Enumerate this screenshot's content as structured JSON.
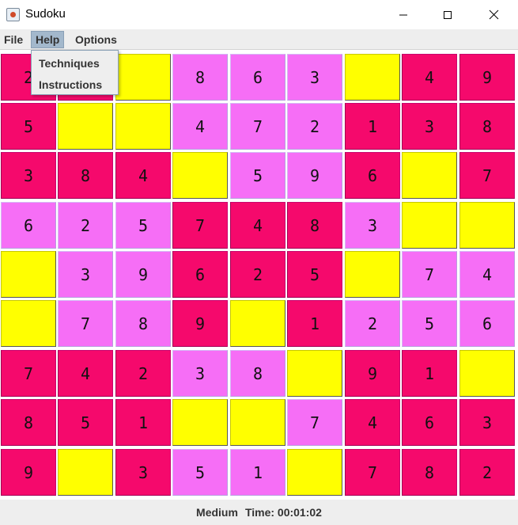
{
  "window": {
    "title": "Sudoku"
  },
  "menu": {
    "file": "File",
    "help": "Help",
    "options": "Options"
  },
  "help_menu": {
    "items": [
      "Techniques",
      "Instructions"
    ]
  },
  "board": {
    "rows": [
      [
        "2",
        "",
        "",
        "8",
        "6",
        "3",
        "",
        "4",
        "9"
      ],
      [
        "5",
        "",
        "",
        "4",
        "7",
        "2",
        "1",
        "3",
        "8"
      ],
      [
        "3",
        "8",
        "4",
        "",
        "5",
        "9",
        "6",
        "",
        "7"
      ],
      [
        "6",
        "2",
        "5",
        "7",
        "4",
        "8",
        "3",
        "",
        ""
      ],
      [
        "",
        "3",
        "9",
        "6",
        "2",
        "5",
        "",
        "7",
        "4"
      ],
      [
        "",
        "7",
        "8",
        "9",
        "",
        "1",
        "2",
        "5",
        "6"
      ],
      [
        "7",
        "4",
        "2",
        "3",
        "8",
        "",
        "9",
        "1",
        ""
      ],
      [
        "8",
        "5",
        "1",
        "",
        "",
        "7",
        "4",
        "6",
        "3"
      ],
      [
        "9",
        "",
        "3",
        "5",
        "1",
        "",
        "7",
        "8",
        "2"
      ]
    ],
    "colors": [
      [
        "red",
        "red",
        "yellow",
        "pink",
        "pink",
        "pink",
        "yellow",
        "red",
        "red"
      ],
      [
        "red",
        "yellow",
        "yellow",
        "pink",
        "pink",
        "pink",
        "red",
        "red",
        "red"
      ],
      [
        "red",
        "red",
        "red",
        "yellow",
        "pink",
        "pink",
        "red",
        "yellow",
        "red"
      ],
      [
        "pink",
        "pink",
        "pink",
        "red",
        "red",
        "red",
        "pink",
        "yellow",
        "yellow"
      ],
      [
        "yellow",
        "pink",
        "pink",
        "red",
        "red",
        "red",
        "yellow",
        "pink",
        "pink"
      ],
      [
        "yellow",
        "pink",
        "pink",
        "red",
        "yellow",
        "red",
        "pink",
        "pink",
        "pink"
      ],
      [
        "red",
        "red",
        "red",
        "pink",
        "pink",
        "yellow",
        "red",
        "red",
        "yellow"
      ],
      [
        "red",
        "red",
        "red",
        "yellow",
        "yellow",
        "pink",
        "red",
        "red",
        "red"
      ],
      [
        "red",
        "yellow",
        "red",
        "pink",
        "pink",
        "yellow",
        "red",
        "red",
        "red"
      ]
    ],
    "palette": {
      "red": "#f5096c",
      "pink": "#f66ef6",
      "yellow": "#ffff00"
    }
  },
  "status": {
    "difficulty": "Medium",
    "time": "Time: 00:01:02"
  }
}
